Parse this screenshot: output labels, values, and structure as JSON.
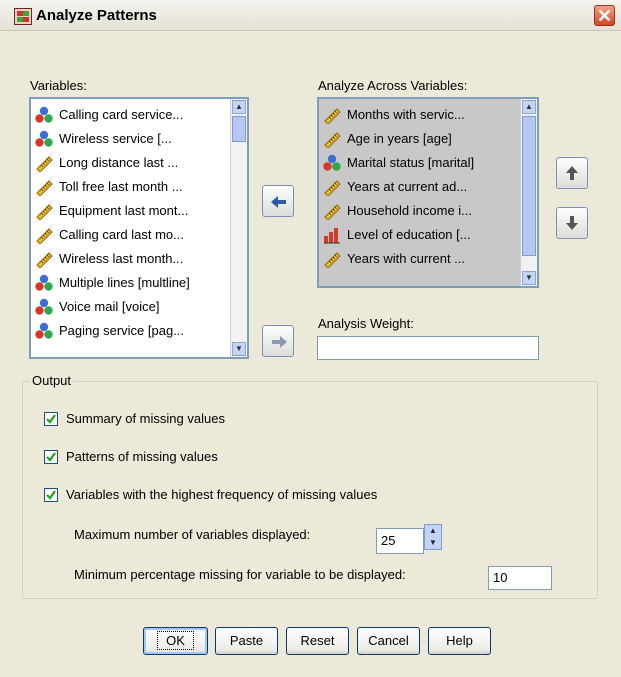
{
  "window": {
    "title": "Analyze Patterns",
    "close_glyph": "✕"
  },
  "variables": {
    "label": "Variables:",
    "items": [
      {
        "label": "Calling card service...",
        "icon": "nominal-icon"
      },
      {
        "label": "Wireless service [...",
        "icon": "nominal-icon"
      },
      {
        "label": "Long distance last ...",
        "icon": "scale-icon"
      },
      {
        "label": "Toll free last month ...",
        "icon": "scale-icon"
      },
      {
        "label": "Equipment last mont...",
        "icon": "scale-icon"
      },
      {
        "label": "Calling card last mo...",
        "icon": "scale-icon"
      },
      {
        "label": "Wireless last month...",
        "icon": "scale-icon"
      },
      {
        "label": "Multiple lines [multline]",
        "icon": "nominal-icon"
      },
      {
        "label": "Voice mail [voice]",
        "icon": "nominal-icon"
      },
      {
        "label": "Paging service [pag...",
        "icon": "nominal-icon"
      }
    ]
  },
  "analyze_across": {
    "label": "Analyze Across Variables:",
    "items": [
      {
        "label": "Months with servic...",
        "icon": "scale-icon"
      },
      {
        "label": "Age in years [age]",
        "icon": "scale-icon"
      },
      {
        "label": "Marital status [marital]",
        "icon": "nominal-icon"
      },
      {
        "label": "Years at current ad...",
        "icon": "scale-icon"
      },
      {
        "label": "Household income i...",
        "icon": "scale-icon"
      },
      {
        "label": "Level of education [...",
        "icon": "ordinal-icon"
      },
      {
        "label": "Years with current ...",
        "icon": "scale-icon"
      }
    ]
  },
  "weight": {
    "label": "Analysis Weight:",
    "value": ""
  },
  "output": {
    "group_label": "Output",
    "summary": {
      "label": "Summary of missing values",
      "checked": true
    },
    "patterns": {
      "label": "Patterns of missing values",
      "checked": true
    },
    "highest": {
      "label": "Variables with the highest frequency of missing values",
      "checked": true
    },
    "max_vars": {
      "label": "Maximum number of variables displayed:",
      "value": "25"
    },
    "min_pct": {
      "label": "Minimum percentage missing for variable to be displayed:",
      "value": "10"
    }
  },
  "buttons": {
    "ok": "OK",
    "paste": "Paste",
    "reset": "Reset",
    "cancel": "Cancel",
    "help": "Help"
  },
  "colors": {
    "accent": "#316ac5",
    "dialog_bg": "#ece9d8"
  }
}
